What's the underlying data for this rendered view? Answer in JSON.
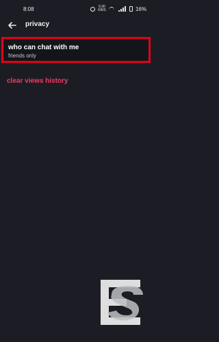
{
  "status_bar": {
    "time": "8:08",
    "speed": "5.00 KB/S",
    "battery_percent": "16%"
  },
  "header": {
    "title": "privacy"
  },
  "settings": {
    "chat_permission": {
      "title": "who can chat with me",
      "value": "friends only"
    },
    "clear_views_history": "clear views history"
  },
  "colors": {
    "background": "#1c1d24",
    "highlight": "#e3001b",
    "link": "#f23b61"
  },
  "icons": {
    "back": "arrow-left-icon",
    "alarm": "alarm-icon",
    "wifi": "wifi-icon",
    "signal": "signal-icon",
    "battery": "battery-icon",
    "watermark": "watermark-logo"
  }
}
